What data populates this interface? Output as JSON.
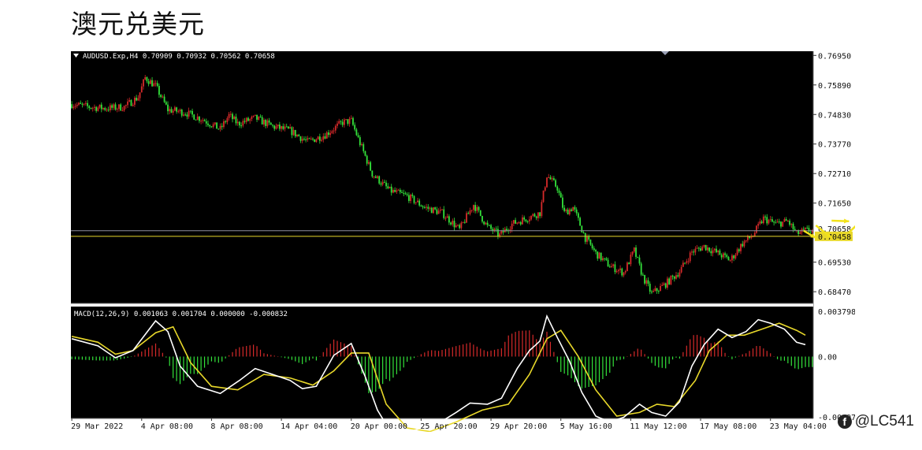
{
  "page": {
    "title": "澳元兑美元"
  },
  "watermark": {
    "handle": "@LC541",
    "icon": "facebook-icon"
  },
  "colors": {
    "background": "#000000",
    "bull": "#d62a2a",
    "bear": "#33e23a",
    "macd_line": "#ffffff",
    "signal_line": "#e8d82a",
    "forecast_arrow": "#f2e21a",
    "bid_line": "#8e8e9e",
    "ask_line": "#e8d82a"
  },
  "chart_data": {
    "type": "candlestick",
    "symbol_header": "AUDUSD.Exp,H4  0.70909 0.70932 0.70562 0.70658",
    "ylim": [
      0.6805,
      0.771
    ],
    "price_ticks": [
      "0.76950",
      "0.75890",
      "0.74830",
      "0.73770",
      "0.72710",
      "0.71650",
      "0.70658",
      "0.69530",
      "0.68470"
    ],
    "price_tick_values": [
      0.7695,
      0.7589,
      0.7483,
      0.7377,
      0.7271,
      0.7165,
      0.70658,
      0.6953,
      0.6847
    ],
    "bid_label": "0.70658",
    "bid_value": 0.70658,
    "ask_label": "0.70458",
    "ask_value": 0.70458,
    "x_labels": [
      "29 Mar 2022",
      "4 Apr 08:00",
      "8 Apr 08:00",
      "14 Apr 04:00",
      "20 Apr 00:00",
      "25 Apr 20:00",
      "29 Apr 20:00",
      "5 May 16:00",
      "11 May 12:00",
      "17 May 08:00",
      "23 May 04:00"
    ],
    "x_label_positions": [
      0,
      40,
      80,
      120,
      160,
      200,
      240,
      280,
      320,
      360,
      400
    ],
    "bar_count": 425,
    "close_path": [
      [
        0,
        0.752
      ],
      [
        10,
        0.751
      ],
      [
        20,
        0.7505
      ],
      [
        30,
        0.751
      ],
      [
        38,
        0.7545
      ],
      [
        42,
        0.7615
      ],
      [
        48,
        0.7585
      ],
      [
        55,
        0.75
      ],
      [
        65,
        0.749
      ],
      [
        75,
        0.7465
      ],
      [
        85,
        0.743
      ],
      [
        90,
        0.748
      ],
      [
        95,
        0.745
      ],
      [
        105,
        0.747
      ],
      [
        115,
        0.744
      ],
      [
        125,
        0.7425
      ],
      [
        135,
        0.7385
      ],
      [
        145,
        0.741
      ],
      [
        155,
        0.7455
      ],
      [
        160,
        0.746
      ],
      [
        165,
        0.738
      ],
      [
        172,
        0.727
      ],
      [
        182,
        0.721
      ],
      [
        192,
        0.719
      ],
      [
        202,
        0.715
      ],
      [
        212,
        0.713
      ],
      [
        222,
        0.707
      ],
      [
        230,
        0.716
      ],
      [
        238,
        0.708
      ],
      [
        245,
        0.705
      ],
      [
        252,
        0.709
      ],
      [
        260,
        0.711
      ],
      [
        268,
        0.713
      ],
      [
        272,
        0.7265
      ],
      [
        278,
        0.722
      ],
      [
        282,
        0.713
      ],
      [
        287,
        0.715
      ],
      [
        294,
        0.704
      ],
      [
        300,
        0.6985
      ],
      [
        308,
        0.694
      ],
      [
        316,
        0.6915
      ],
      [
        322,
        0.6995
      ],
      [
        327,
        0.69
      ],
      [
        332,
        0.684
      ],
      [
        340,
        0.6875
      ],
      [
        348,
        0.692
      ],
      [
        355,
        0.699
      ],
      [
        362,
        0.701
      ],
      [
        370,
        0.6985
      ],
      [
        377,
        0.696
      ],
      [
        384,
        0.702
      ],
      [
        390,
        0.705
      ],
      [
        396,
        0.711
      ],
      [
        403,
        0.709
      ],
      [
        410,
        0.71
      ],
      [
        415,
        0.7055
      ],
      [
        420,
        0.7066
      ]
    ],
    "forecast_path": [
      [
        0.7066,
        0.704
      ],
      [
        0.7085,
        0.704
      ],
      [
        0.7102,
        0.71
      ],
      [
        0.706,
        0.712
      ],
      [
        0.716,
        0.712
      ]
    ],
    "macd": {
      "label": "MACD(12,26,9) 0.001063 0.001704 0.000000 -0.000832",
      "ylim": [
        -0.0052,
        0.0042
      ],
      "ticks": [
        "0.003798",
        "0.00",
        "-0.004978"
      ],
      "tick_values": [
        0.003798,
        0.0,
        -0.004978
      ],
      "macd_line": [
        [
          0,
          0.0015
        ],
        [
          15,
          0.0009
        ],
        [
          25,
          -0.0001
        ],
        [
          35,
          0.0005
        ],
        [
          48,
          0.003
        ],
        [
          55,
          0.0021
        ],
        [
          62,
          -0.0008
        ],
        [
          72,
          -0.0025
        ],
        [
          85,
          -0.0031
        ],
        [
          96,
          -0.002
        ],
        [
          105,
          -0.001
        ],
        [
          115,
          -0.0015
        ],
        [
          125,
          -0.002
        ],
        [
          132,
          -0.0027
        ],
        [
          140,
          -0.0025
        ],
        [
          150,
          0.0001
        ],
        [
          160,
          0.0011
        ],
        [
          168,
          -0.0017
        ],
        [
          175,
          -0.0045
        ],
        [
          182,
          -0.0062
        ],
        [
          190,
          -0.0065
        ],
        [
          200,
          -0.006
        ],
        [
          210,
          -0.0056
        ],
        [
          220,
          -0.0047
        ],
        [
          228,
          -0.0039
        ],
        [
          238,
          -0.004
        ],
        [
          246,
          -0.0035
        ],
        [
          255,
          -0.001
        ],
        [
          262,
          0.0005
        ],
        [
          268,
          0.0013
        ],
        [
          272,
          0.0034
        ],
        [
          278,
          0.0016
        ],
        [
          285,
          -0.0004
        ],
        [
          292,
          -0.003
        ],
        [
          300,
          -0.005
        ],
        [
          308,
          -0.0055
        ],
        [
          316,
          -0.0051
        ],
        [
          325,
          -0.004
        ],
        [
          332,
          -0.0047
        ],
        [
          340,
          -0.005
        ],
        [
          348,
          -0.0038
        ],
        [
          355,
          -0.0008
        ],
        [
          362,
          0.001
        ],
        [
          370,
          0.0023
        ],
        [
          378,
          0.0016
        ],
        [
          386,
          0.0021
        ],
        [
          393,
          0.0031
        ],
        [
          400,
          0.0028
        ],
        [
          408,
          0.0023
        ],
        [
          415,
          0.0012
        ],
        [
          420,
          0.001
        ]
      ],
      "signal_line": [
        [
          0,
          0.0017
        ],
        [
          15,
          0.0012
        ],
        [
          25,
          0.0002
        ],
        [
          35,
          0.0005
        ],
        [
          48,
          0.002
        ],
        [
          58,
          0.0025
        ],
        [
          68,
          -0.0005
        ],
        [
          80,
          -0.0025
        ],
        [
          95,
          -0.0028
        ],
        [
          110,
          -0.0015
        ],
        [
          125,
          -0.0018
        ],
        [
          138,
          -0.0024
        ],
        [
          150,
          -0.0012
        ],
        [
          160,
          0.0003
        ],
        [
          170,
          0.0003
        ],
        [
          180,
          -0.004
        ],
        [
          192,
          -0.006
        ],
        [
          205,
          -0.0063
        ],
        [
          220,
          -0.0055
        ],
        [
          235,
          -0.0045
        ],
        [
          250,
          -0.004
        ],
        [
          262,
          -0.0015
        ],
        [
          272,
          0.0015
        ],
        [
          280,
          0.0022
        ],
        [
          290,
          0.0
        ],
        [
          300,
          -0.0028
        ],
        [
          312,
          -0.005
        ],
        [
          325,
          -0.0047
        ],
        [
          335,
          -0.004
        ],
        [
          345,
          -0.0042
        ],
        [
          357,
          -0.002
        ],
        [
          365,
          0.0005
        ],
        [
          375,
          0.0018
        ],
        [
          385,
          0.0018
        ],
        [
          395,
          0.0023
        ],
        [
          405,
          0.0028
        ],
        [
          415,
          0.0022
        ],
        [
          420,
          0.0018
        ]
      ]
    }
  }
}
